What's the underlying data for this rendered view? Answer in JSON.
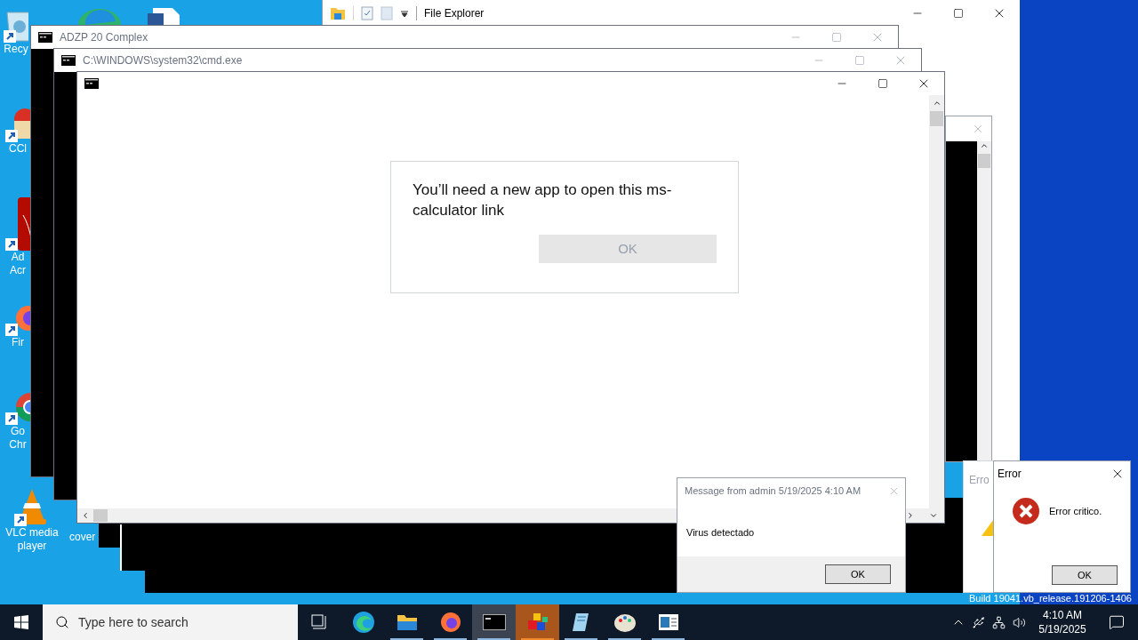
{
  "desktop": {
    "icons": [
      {
        "kind": "recycle",
        "label": [
          "Recy"
        ]
      },
      {
        "kind": "ccleaner",
        "label": [
          "CCl"
        ]
      },
      {
        "kind": "acrobat",
        "label": [
          "Ad",
          "Acr"
        ]
      },
      {
        "kind": "firefox",
        "label": [
          "Fir"
        ]
      },
      {
        "kind": "chrome",
        "label": [
          "Go",
          "Chr"
        ]
      },
      {
        "kind": "vlc",
        "label": [
          "VLC media",
          "player"
        ]
      },
      {
        "kind": "file",
        "label": [
          "cover"
        ]
      }
    ],
    "build_text": "Build 19041.vb_release.191206-1406"
  },
  "file_explorer": {
    "title": "File Explorer",
    "active": true
  },
  "consoles": [
    {
      "title": "ADZP 20 Complex",
      "active": false
    },
    {
      "title": "C:\\WINDOWS\\system32\\cmd.exe",
      "active": false
    }
  ],
  "front_window": {
    "active": true,
    "prompt": {
      "message": "You’ll need a new app to open this ms-calculator link",
      "button": {
        "label": "OK",
        "disabled": true
      }
    }
  },
  "message_box": {
    "title": "Message from admin 5/19/2025 4:10 AM",
    "text": "Virus detectado",
    "button": "OK"
  },
  "error_back": {
    "title": "Erro"
  },
  "error_box": {
    "title": "Error",
    "text": "Error critico.",
    "button": "OK"
  },
  "taskbar": {
    "search_placeholder": "Type here to search",
    "apps": [
      {
        "kind": "task-view",
        "open": false,
        "selected": false,
        "flashing": false
      },
      {
        "kind": "edge",
        "open": false,
        "selected": false,
        "flashing": false
      },
      {
        "kind": "folder",
        "open": true,
        "selected": false,
        "flashing": false
      },
      {
        "kind": "firefox",
        "open": true,
        "selected": false,
        "flashing": false
      },
      {
        "kind": "console",
        "open": true,
        "selected": true,
        "flashing": false
      },
      {
        "kind": "cubes",
        "open": true,
        "selected": false,
        "flashing": true
      },
      {
        "kind": "notepad",
        "open": true,
        "selected": false,
        "flashing": false
      },
      {
        "kind": "paint",
        "open": true,
        "selected": false,
        "flashing": false
      },
      {
        "kind": "app",
        "open": true,
        "selected": false,
        "flashing": false
      }
    ],
    "time": "4:10 AM",
    "date": "5/19/2025"
  }
}
